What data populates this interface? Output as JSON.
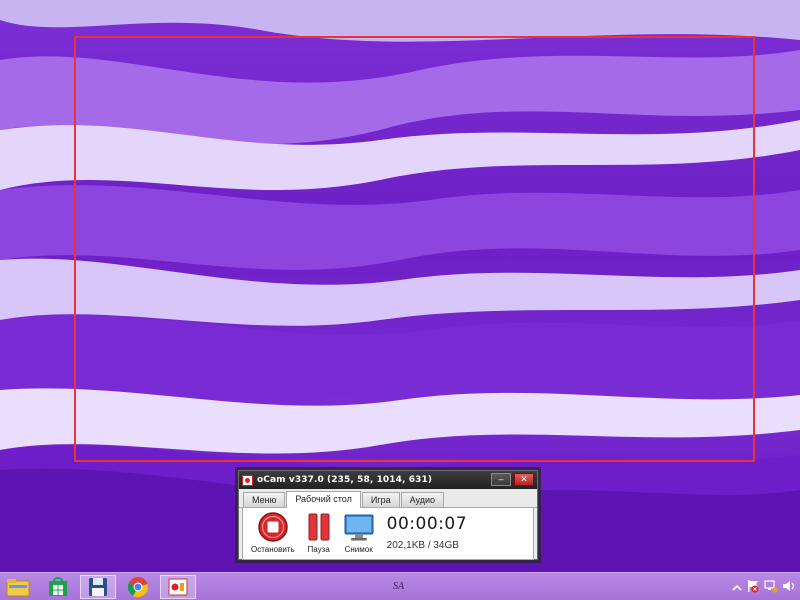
{
  "window": {
    "title": "oCam v337.0 (235, 58, 1014, 631)",
    "minimize_glyph": "–",
    "close_glyph": "✕"
  },
  "tabs": [
    {
      "label": "Меню",
      "active": false
    },
    {
      "label": "Рабочий стол",
      "active": true
    },
    {
      "label": "Игра",
      "active": false
    },
    {
      "label": "Аудио",
      "active": false
    }
  ],
  "tools": {
    "stop_label": "Остановить",
    "pause_label": "Пауза",
    "snapshot_label": "Снимок"
  },
  "status": {
    "timer": "00:00:07",
    "file_size": "202,1KB / 34GB"
  },
  "taskbar": {
    "signature": "SA",
    "items": [
      "file-explorer-icon",
      "store-icon",
      "floppy-save-icon",
      "chrome-icon",
      "ocam-icon"
    ]
  },
  "colors": {
    "capture_frame": "#e8323c",
    "wallpaper": "#7a2cd4",
    "taskbar": "#b084e0"
  }
}
